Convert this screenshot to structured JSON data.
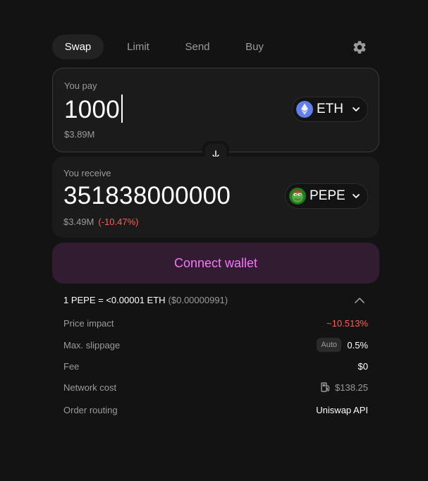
{
  "tabs": [
    {
      "label": "Swap",
      "active": true
    },
    {
      "label": "Limit",
      "active": false
    },
    {
      "label": "Send",
      "active": false
    },
    {
      "label": "Buy",
      "active": false
    }
  ],
  "settings_icon": "gear-icon",
  "pay": {
    "label": "You pay",
    "amount": "1000",
    "usd_value": "$3.89M",
    "token": {
      "symbol": "ETH",
      "icon": "eth-icon",
      "color": "#627EEA"
    }
  },
  "switch_icon": "arrow-down-icon",
  "receive": {
    "label": "You receive",
    "amount": "351838000000",
    "usd_value": "$3.49M",
    "price_change": "(-10.47%)",
    "token": {
      "symbol": "PEPE",
      "icon": "pepe-icon",
      "color": "#3E8E2C"
    }
  },
  "connect_button": {
    "label": "Connect wallet",
    "color": "#FC72FF"
  },
  "rate": {
    "main": "1 PEPE = <0.00001 ETH",
    "usd": "($0.00000991)"
  },
  "details": {
    "price_impact": {
      "label": "Price impact",
      "value": "~10.513%"
    },
    "max_slippage": {
      "label": "Max. slippage",
      "badge": "Auto",
      "value": "0.5%"
    },
    "fee": {
      "label": "Fee",
      "value": "$0"
    },
    "network_cost": {
      "label": "Network cost",
      "value": "$138.25",
      "icon": "gas-pump-icon"
    },
    "order_routing": {
      "label": "Order routing",
      "value": "Uniswap API"
    }
  },
  "colors": {
    "background": "#131313",
    "panel": "#1B1B1B",
    "accent": "#FC72FF",
    "negative": "#FF5F52"
  }
}
